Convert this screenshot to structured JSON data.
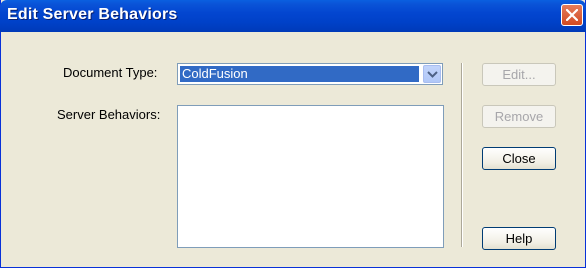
{
  "dialog": {
    "title": "Edit Server Behaviors",
    "close_icon": "close-x-icon"
  },
  "form": {
    "document_type_label": "Document Type:",
    "document_type_value": "ColdFusion",
    "server_behaviors_label": "Server Behaviors:",
    "server_behaviors_items": []
  },
  "buttons": {
    "edit": "Edit...",
    "remove": "Remove",
    "close": "Close",
    "help": "Help"
  },
  "colors": {
    "title_bar": "#0a54d8",
    "selection": "#316ac5",
    "dialog_bg": "#ece9d8",
    "close_button": "#d24a22"
  }
}
